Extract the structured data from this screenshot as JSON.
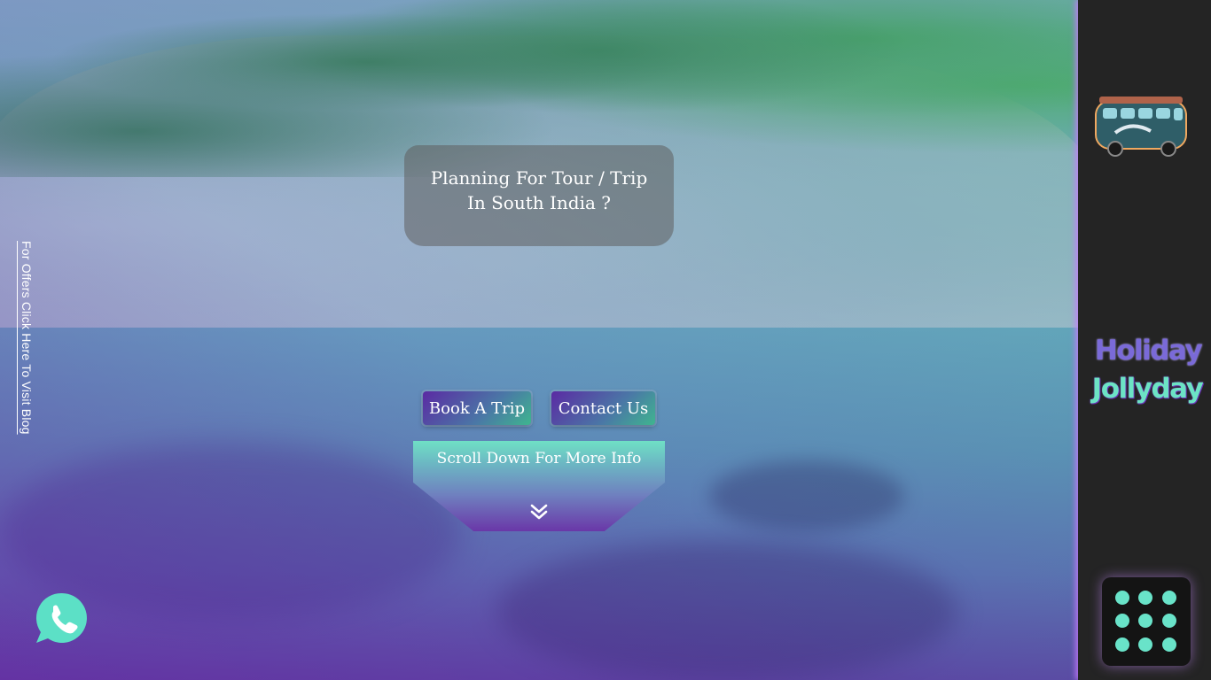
{
  "blog_link": {
    "label": "For Offers Click Here To Visit Blog"
  },
  "headline": {
    "text": "Planning For Tour / Trip\nIn South India ?"
  },
  "buttons": {
    "book": "Book A Trip",
    "contact": "Contact Us"
  },
  "scroll": {
    "label": "Scroll Down For More Info",
    "icon": "double-chevron-down-icon"
  },
  "phone": {
    "icon": "phone-icon"
  },
  "sidebar": {
    "logo_icon": "bus-icon",
    "brand_line1": "Holiday",
    "brand_line2": "Jollyday",
    "menu_icon": "grid-menu-icon"
  },
  "colors": {
    "accent_teal": "#69e3c9",
    "accent_purple": "#6a37a8",
    "sidebar_bg": "#242424"
  }
}
